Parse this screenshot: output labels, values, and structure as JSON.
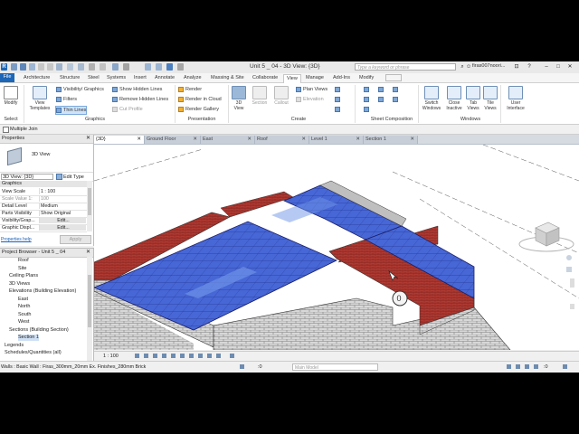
{
  "window": {
    "title": "Unit 5 _ 04 - 3D View: {3D}",
    "search_placeholder": "Type a keyword or phrase",
    "user": "firas007noori..."
  },
  "ribbon_tabs": [
    "File",
    "Architecture",
    "Structure",
    "Steel",
    "Systems",
    "Insert",
    "Annotate",
    "Analyze",
    "Massing & Site",
    "Collaborate",
    "View",
    "Manage",
    "Add-Ins",
    "Modify"
  ],
  "active_tab": "View",
  "ribbon": {
    "select": {
      "modify": "Modify",
      "label": "Select"
    },
    "graphics": {
      "view_templates": "View Templates",
      "visibility_graphics": "Visibility/ Graphics",
      "filters": "Filters",
      "thin_lines": "Thin Lines",
      "show_hidden_lines": "Show Hidden Lines",
      "remove_hidden_lines": "Remove Hidden Lines",
      "cut_profile": "Cut Profile",
      "label": "Graphics"
    },
    "presentation": {
      "render": "Render",
      "render_in_cloud": "Render in Cloud",
      "render_gallery": "Render Gallery",
      "label": "Presentation"
    },
    "create": {
      "view_3d": "3D View",
      "section": "Section",
      "callout": "Callout",
      "plan_views": "Plan Views",
      "elevation": "Elevation",
      "label": "Create"
    },
    "sheet_composition": {
      "label": "Sheet Composition"
    },
    "windows": {
      "switch_windows": "Switch Windows",
      "close_inactive": "Close Inactive",
      "tab_views": "Tab Views",
      "tile_views": "Tile Views",
      "user_interface": "User Interface",
      "label": "Windows"
    }
  },
  "options_bar": {
    "multiple_join": "Multiple Join"
  },
  "properties": {
    "title": "Properties",
    "type_name": "3D View",
    "instance": "3D View: {3D}",
    "edit_type": "Edit Type",
    "category": "Graphics",
    "rows": [
      {
        "key": "View Scale",
        "value": "1 : 100"
      },
      {
        "key": "Scale Value 1:",
        "value": "100"
      },
      {
        "key": "Detail Level",
        "value": "Medium"
      },
      {
        "key": "Parts Visibility",
        "value": "Show Original"
      },
      {
        "key": "Visibility/Grap...",
        "value": "Edit..."
      },
      {
        "key": "Graphic Displ...",
        "value": "Edit..."
      }
    ],
    "help": "Properties help",
    "apply": "Apply"
  },
  "project_browser": {
    "title": "Project Browser - Unit 5 _ 04",
    "items": [
      {
        "label": "Roof",
        "indent": 4
      },
      {
        "label": "Site",
        "indent": 4
      },
      {
        "label": "Ceiling Plans",
        "indent": 2
      },
      {
        "label": "3D Views",
        "indent": 2
      },
      {
        "label": "Elevations (Building Elevation)",
        "indent": 2
      },
      {
        "label": "East",
        "indent": 4
      },
      {
        "label": "North",
        "indent": 4
      },
      {
        "label": "South",
        "indent": 4
      },
      {
        "label": "West",
        "indent": 4
      },
      {
        "label": "Sections (Building Section)",
        "indent": 2
      },
      {
        "label": "Section 1",
        "indent": 4
      },
      {
        "label": "Legends",
        "indent": 1
      },
      {
        "label": "Schedules/Quantities (all)",
        "indent": 1
      }
    ]
  },
  "view_tabs": [
    "{3D}",
    "Ground Floor",
    "East",
    "Roof",
    "Level 1",
    "Section 1"
  ],
  "active_view_tab": "{3D}",
  "view_control": {
    "scale": "1 : 100"
  },
  "status_bar": {
    "text": "Walls : Basic Wall : Firas_300mm_20mm Ex. Finishes_280mm Brick",
    "model": "Main Model",
    "left_num": ":0",
    "right_num": ":0"
  }
}
